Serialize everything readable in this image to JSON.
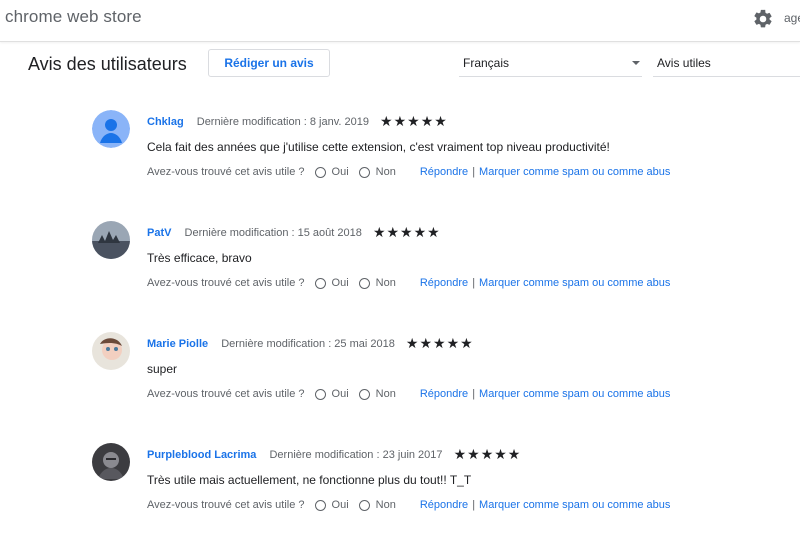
{
  "header": {
    "store_title": "chrome web store",
    "gear_icon": "gear-icon",
    "account_text": "age"
  },
  "toolbar": {
    "section_title": "Avis des utilisateurs",
    "write_review_label": "Rédiger un avis",
    "language_value": "Français",
    "sort_value": "Avis utiles"
  },
  "review_labels": {
    "modified_prefix": "Dernière modification : ",
    "helpful_question": "Avez-vous trouvé cet avis utile ?",
    "yes_label": "Oui",
    "no_label": "Non",
    "reply_label": "Répondre",
    "separator": "|",
    "report_label": "Marquer comme spam ou comme abus",
    "stars_glyphs": "★★★★★"
  },
  "reviews": [
    {
      "author": "Chklag",
      "date": "8 janv. 2019",
      "rating": 5,
      "comment": "Cela fait des années que j'utilise cette extension, c'est vraiment top niveau productivité!"
    },
    {
      "author": "PatV",
      "date": "15 août 2018",
      "rating": 5,
      "comment": "Très efficace, bravo"
    },
    {
      "author": "Marie Piolle",
      "date": "25 mai 2018",
      "rating": 5,
      "comment": "super"
    },
    {
      "author": "Purpleblood Lacrima",
      "date": "23 juin 2017",
      "rating": 5,
      "comment": "Très utile mais actuellement, ne fonctionne plus du tout!! T_T"
    }
  ],
  "colors": {
    "link": "#1a73e8",
    "text": "#202124",
    "muted": "#5f6368",
    "default_avatar": "#8ab4f8"
  }
}
